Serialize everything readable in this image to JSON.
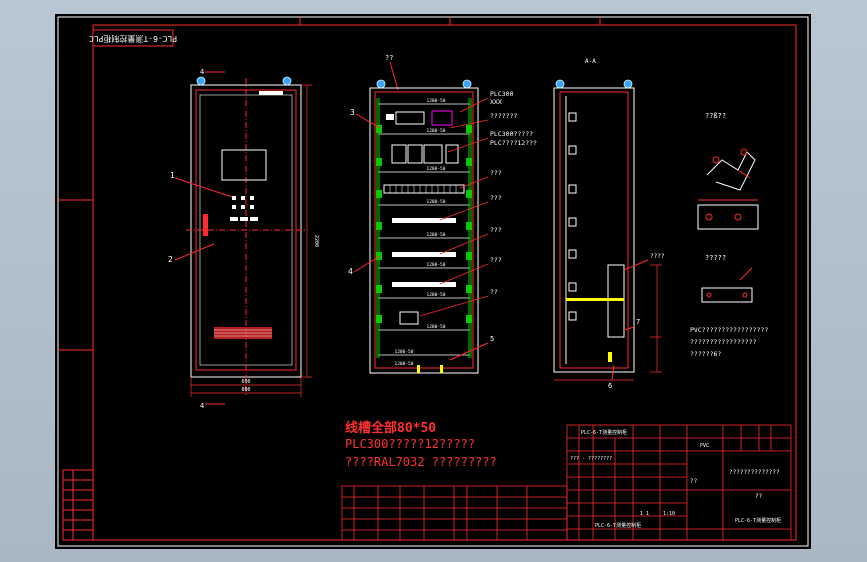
{
  "viewport_bg": "#a9b7c5",
  "drawing": {
    "sheet_color": "#000000",
    "frame_color": "#ffffff",
    "line_color": "#ff2a2a",
    "dim_color": "#ff3030",
    "label_color": "#ffffff",
    "accent_green": "#00ff00",
    "accent_yellow": "#ffff00",
    "accent_cyan": "#00ffff",
    "accent_magenta": "#ff00ff",
    "rotated_title": "PLC-6-T测量控制柜PLC",
    "front_view": {
      "top_mark": "4",
      "bottom_mark": "4",
      "callouts": [
        "1",
        "2"
      ],
      "width_dim_1": "600",
      "width_dim_2": "800",
      "height_dim": "2200"
    },
    "interior_view": {
      "top_label": "??",
      "callouts_left": [
        "3",
        "4"
      ],
      "callout_bottom": "5",
      "annotations": [
        "PLC300",
        "XXX",
        "???????",
        "PLC300?????",
        "PLC????12???",
        "???",
        "???",
        "???",
        "???",
        "??"
      ],
      "rail_labels": [
        "1200-50",
        "1200-50",
        "1200-50",
        "1200-50",
        "1200-50",
        "1200-50",
        "1200-50",
        "1200-50",
        "1200-50",
        "1200-50"
      ]
    },
    "side_view": {
      "title": "A-A",
      "callouts": [
        "7",
        "6"
      ],
      "annotation": "????"
    },
    "details": {
      "label_1": "??ß??",
      "label_2": "?????",
      "note_1": "PVC?????????????????",
      "note_2": "?????????????????",
      "note_3": "??????6?"
    },
    "notes": {
      "line_1": "线槽全部80*50",
      "line_2": "PLC300?????12?????",
      "line_3": "????RAL7032 ?????????"
    },
    "title_block": {
      "company_header": "PLC-6-T测量控制柜",
      "revision": "??? · ????????",
      "scale": "1:10",
      "sheet_no": "1 1",
      "material": "??????????????",
      "name_cell": "??",
      "drawing_title": "PLC-6-T测量控制柜",
      "drawing_number": "PLC-6-T测量控制柜",
      "designer": "PVC",
      "qty": "??"
    }
  }
}
